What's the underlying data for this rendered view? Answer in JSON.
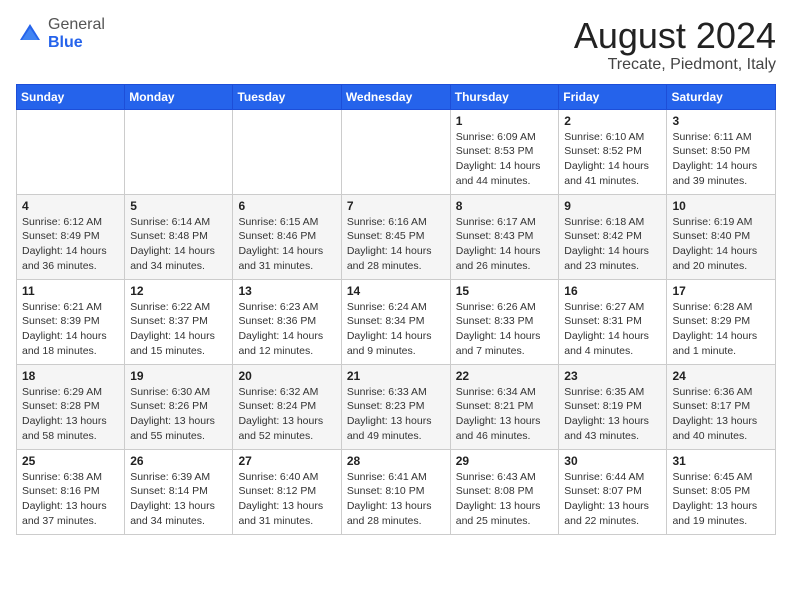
{
  "logo": {
    "general": "General",
    "blue": "Blue"
  },
  "header": {
    "month_year": "August 2024",
    "location": "Trecate, Piedmont, Italy"
  },
  "days_of_week": [
    "Sunday",
    "Monday",
    "Tuesday",
    "Wednesday",
    "Thursday",
    "Friday",
    "Saturday"
  ],
  "weeks": [
    [
      {
        "day": "",
        "info": ""
      },
      {
        "day": "",
        "info": ""
      },
      {
        "day": "",
        "info": ""
      },
      {
        "day": "",
        "info": ""
      },
      {
        "day": "1",
        "info": "Sunrise: 6:09 AM\nSunset: 8:53 PM\nDaylight: 14 hours and 44 minutes."
      },
      {
        "day": "2",
        "info": "Sunrise: 6:10 AM\nSunset: 8:52 PM\nDaylight: 14 hours and 41 minutes."
      },
      {
        "day": "3",
        "info": "Sunrise: 6:11 AM\nSunset: 8:50 PM\nDaylight: 14 hours and 39 minutes."
      }
    ],
    [
      {
        "day": "4",
        "info": "Sunrise: 6:12 AM\nSunset: 8:49 PM\nDaylight: 14 hours and 36 minutes."
      },
      {
        "day": "5",
        "info": "Sunrise: 6:14 AM\nSunset: 8:48 PM\nDaylight: 14 hours and 34 minutes."
      },
      {
        "day": "6",
        "info": "Sunrise: 6:15 AM\nSunset: 8:46 PM\nDaylight: 14 hours and 31 minutes."
      },
      {
        "day": "7",
        "info": "Sunrise: 6:16 AM\nSunset: 8:45 PM\nDaylight: 14 hours and 28 minutes."
      },
      {
        "day": "8",
        "info": "Sunrise: 6:17 AM\nSunset: 8:43 PM\nDaylight: 14 hours and 26 minutes."
      },
      {
        "day": "9",
        "info": "Sunrise: 6:18 AM\nSunset: 8:42 PM\nDaylight: 14 hours and 23 minutes."
      },
      {
        "day": "10",
        "info": "Sunrise: 6:19 AM\nSunset: 8:40 PM\nDaylight: 14 hours and 20 minutes."
      }
    ],
    [
      {
        "day": "11",
        "info": "Sunrise: 6:21 AM\nSunset: 8:39 PM\nDaylight: 14 hours and 18 minutes."
      },
      {
        "day": "12",
        "info": "Sunrise: 6:22 AM\nSunset: 8:37 PM\nDaylight: 14 hours and 15 minutes."
      },
      {
        "day": "13",
        "info": "Sunrise: 6:23 AM\nSunset: 8:36 PM\nDaylight: 14 hours and 12 minutes."
      },
      {
        "day": "14",
        "info": "Sunrise: 6:24 AM\nSunset: 8:34 PM\nDaylight: 14 hours and 9 minutes."
      },
      {
        "day": "15",
        "info": "Sunrise: 6:26 AM\nSunset: 8:33 PM\nDaylight: 14 hours and 7 minutes."
      },
      {
        "day": "16",
        "info": "Sunrise: 6:27 AM\nSunset: 8:31 PM\nDaylight: 14 hours and 4 minutes."
      },
      {
        "day": "17",
        "info": "Sunrise: 6:28 AM\nSunset: 8:29 PM\nDaylight: 14 hours and 1 minute."
      }
    ],
    [
      {
        "day": "18",
        "info": "Sunrise: 6:29 AM\nSunset: 8:28 PM\nDaylight: 13 hours and 58 minutes."
      },
      {
        "day": "19",
        "info": "Sunrise: 6:30 AM\nSunset: 8:26 PM\nDaylight: 13 hours and 55 minutes."
      },
      {
        "day": "20",
        "info": "Sunrise: 6:32 AM\nSunset: 8:24 PM\nDaylight: 13 hours and 52 minutes."
      },
      {
        "day": "21",
        "info": "Sunrise: 6:33 AM\nSunset: 8:23 PM\nDaylight: 13 hours and 49 minutes."
      },
      {
        "day": "22",
        "info": "Sunrise: 6:34 AM\nSunset: 8:21 PM\nDaylight: 13 hours and 46 minutes."
      },
      {
        "day": "23",
        "info": "Sunrise: 6:35 AM\nSunset: 8:19 PM\nDaylight: 13 hours and 43 minutes."
      },
      {
        "day": "24",
        "info": "Sunrise: 6:36 AM\nSunset: 8:17 PM\nDaylight: 13 hours and 40 minutes."
      }
    ],
    [
      {
        "day": "25",
        "info": "Sunrise: 6:38 AM\nSunset: 8:16 PM\nDaylight: 13 hours and 37 minutes."
      },
      {
        "day": "26",
        "info": "Sunrise: 6:39 AM\nSunset: 8:14 PM\nDaylight: 13 hours and 34 minutes."
      },
      {
        "day": "27",
        "info": "Sunrise: 6:40 AM\nSunset: 8:12 PM\nDaylight: 13 hours and 31 minutes."
      },
      {
        "day": "28",
        "info": "Sunrise: 6:41 AM\nSunset: 8:10 PM\nDaylight: 13 hours and 28 minutes."
      },
      {
        "day": "29",
        "info": "Sunrise: 6:43 AM\nSunset: 8:08 PM\nDaylight: 13 hours and 25 minutes."
      },
      {
        "day": "30",
        "info": "Sunrise: 6:44 AM\nSunset: 8:07 PM\nDaylight: 13 hours and 22 minutes."
      },
      {
        "day": "31",
        "info": "Sunrise: 6:45 AM\nSunset: 8:05 PM\nDaylight: 13 hours and 19 minutes."
      }
    ]
  ]
}
